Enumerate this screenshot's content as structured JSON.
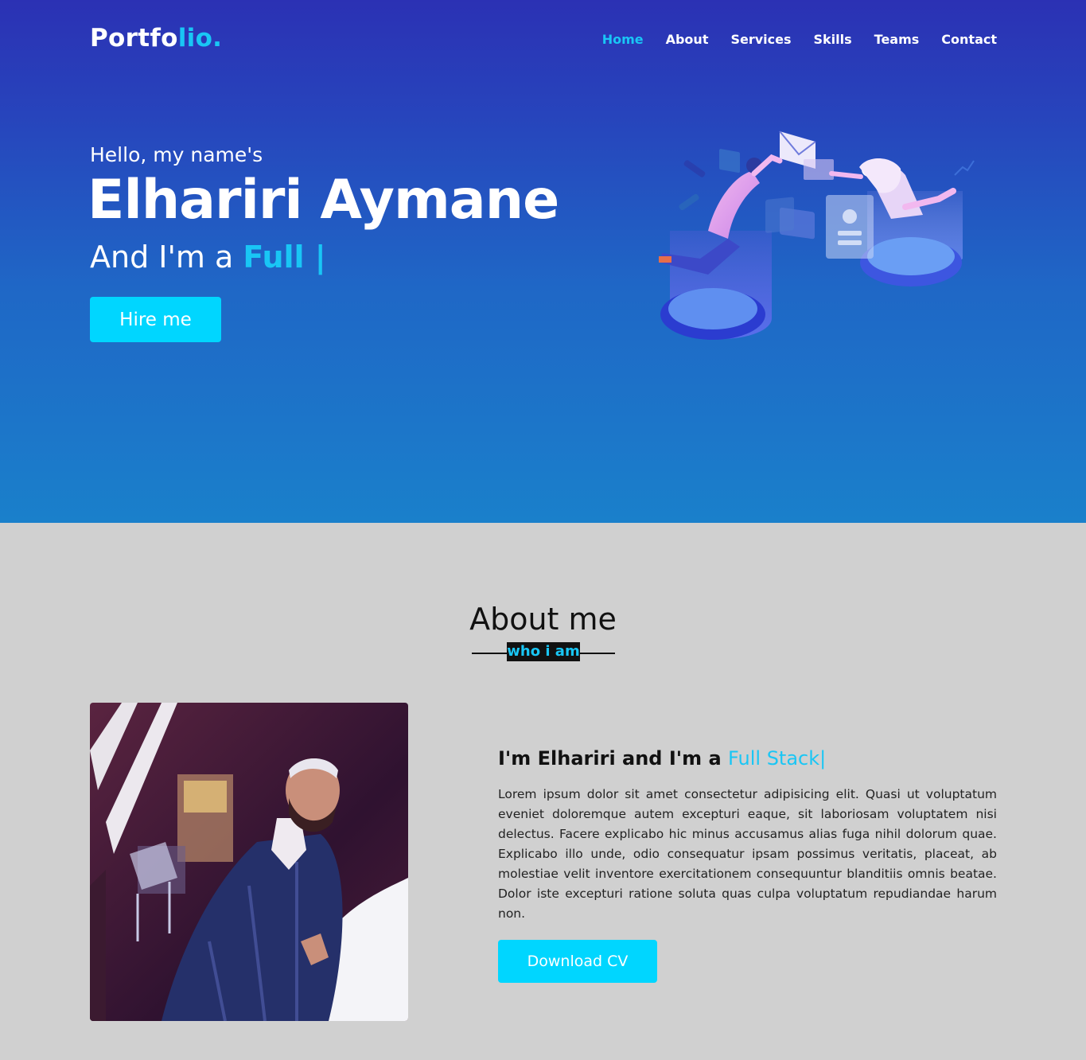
{
  "brand": {
    "text_main": "Portfo",
    "text_accent": "lio."
  },
  "nav": {
    "items": [
      {
        "label": "Home",
        "active": true
      },
      {
        "label": "About"
      },
      {
        "label": "Services"
      },
      {
        "label": "Skills"
      },
      {
        "label": "Teams"
      },
      {
        "label": "Contact"
      }
    ]
  },
  "hero": {
    "greeting": "Hello, my name's",
    "name": "Elhariri Aymane",
    "role_prefix": "And I'm a ",
    "role_typed": "Full |",
    "cta_label": "Hire me",
    "illustration_icon": "team-collaboration-illustration"
  },
  "about": {
    "title": "About me",
    "subtitle": "who i am",
    "photo_icon": "profile-photo",
    "heading_prefix": "I'm Elhariri and I'm a ",
    "heading_typed": "Full Stack|",
    "paragraph": "Lorem ipsum dolor sit amet consectetur adipisicing elit. Quasi ut voluptatum eveniet doloremque autem excepturi eaque, sit laboriosam voluptatem nisi delectus. Facere explicabo hic minus accusamus alias fuga nihil dolorum quae. Explicabo illo unde, odio consequatur ipsam possimus veritatis, placeat, ab molestiae velit inventore exercitationem consequuntur blanditiis omnis beatae. Dolor iste excepturi ratione soluta quas culpa voluptatum repudiandae harum non.",
    "cv_label": "Download CV"
  },
  "colors": {
    "accent": "#19c6f5",
    "button": "#00d6ff",
    "hero_top": "#2b31b4",
    "hero_bottom": "#1a80cb",
    "section_bg": "#d0d0d0"
  }
}
